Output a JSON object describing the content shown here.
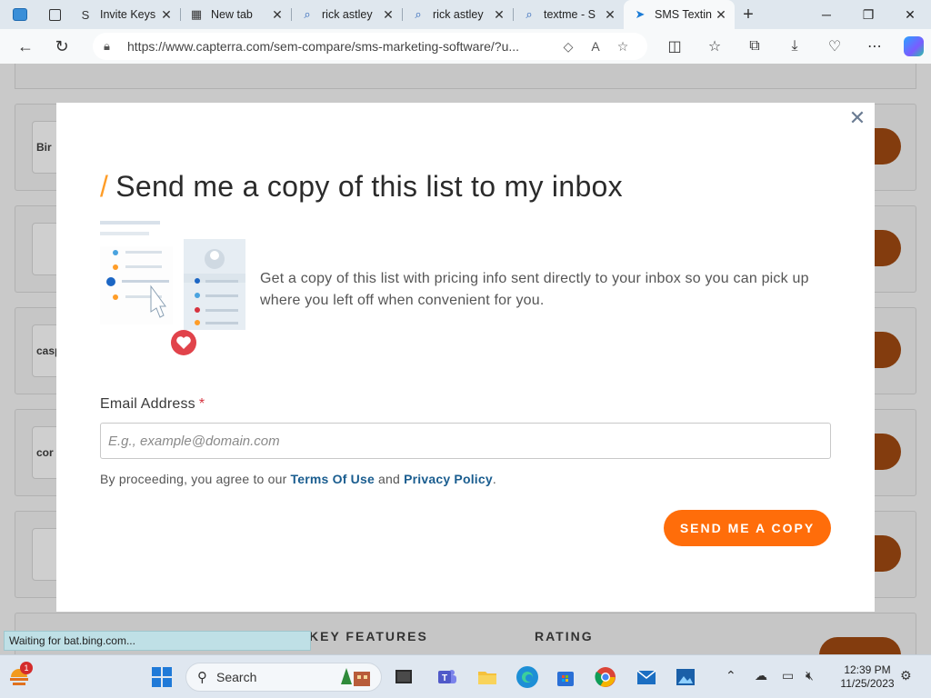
{
  "browser": {
    "tabs": [
      {
        "label": "Invite Keys",
        "fav": "S"
      },
      {
        "label": "New tab",
        "fav": "▦"
      },
      {
        "label": "rick astley",
        "fav": "⌕"
      },
      {
        "label": "rick astley",
        "fav": "⌕"
      },
      {
        "label": "textme - S",
        "fav": "⌕"
      },
      {
        "label": "SMS Textin",
        "fav": "➤",
        "active": true
      }
    ],
    "url": "https://www.capterra.com/sem-compare/sms-marketing-software/?u...",
    "status_text": "Waiting for bat.bing.com..."
  },
  "page_bg": {
    "logos": [
      "Bir",
      "",
      "casp",
      "cor",
      ""
    ],
    "column_headers": {
      "key_features": "KEY FEATURES",
      "rating": "RATING"
    }
  },
  "modal": {
    "slash": "/",
    "title": "Send me a copy of this list to my inbox",
    "intro": "Get a copy of this list with pricing info sent directly to your inbox so you can pick up where you left off when convenient for you.",
    "email_label": "Email Address",
    "required_mark": "*",
    "email_placeholder": "E.g., example@domain.com",
    "terms_prefix": "By proceeding, you agree to our",
    "terms_link": "Terms Of Use",
    "terms_and": "and",
    "privacy_link": "Privacy Policy",
    "terms_suffix": ".",
    "send_label": "SEND ME A COPY",
    "close_glyph": "✕"
  },
  "taskbar": {
    "search_label": "Search",
    "time": "12:39 PM",
    "date": "11/25/2023",
    "notification_count": "1"
  },
  "colors": {
    "accent_orange": "#ff6d0a",
    "slash_orange": "#ff9d28",
    "link_blue": "#1a5d8f"
  }
}
